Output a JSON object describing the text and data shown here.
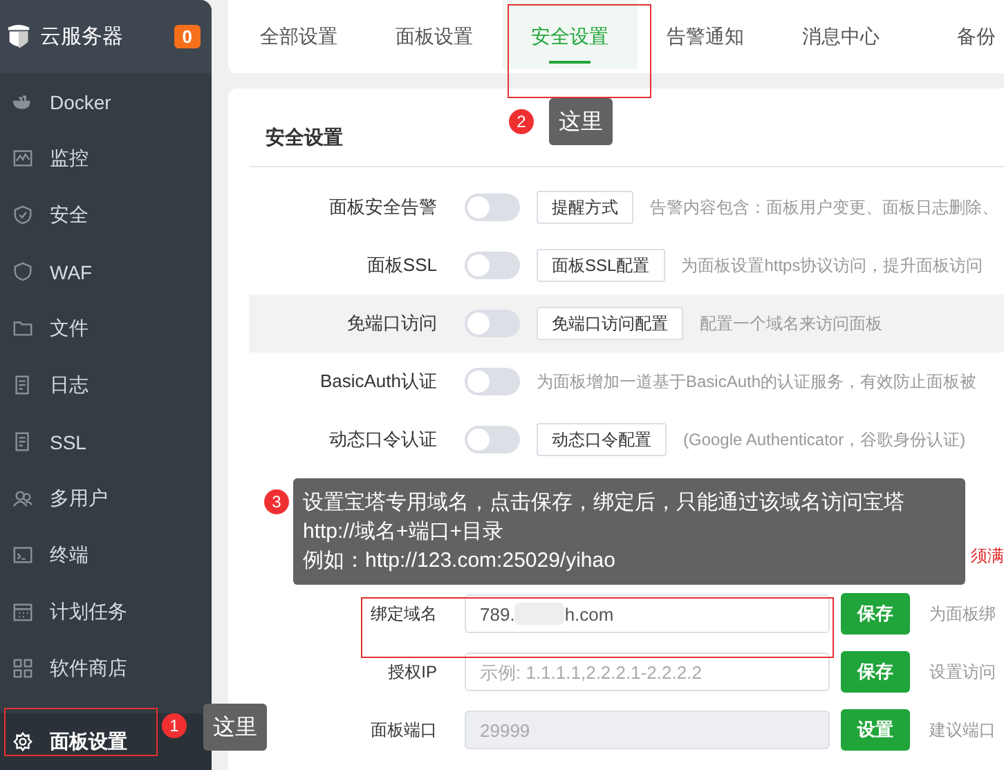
{
  "sidebar": {
    "title": "云服务器",
    "badge": "0",
    "items": [
      {
        "label": "Docker",
        "selected": false
      },
      {
        "label": "监控",
        "selected": false
      },
      {
        "label": "安全",
        "selected": false
      },
      {
        "label": "WAF",
        "selected": false
      },
      {
        "label": "文件",
        "selected": false
      },
      {
        "label": "日志",
        "selected": false
      },
      {
        "label": "SSL",
        "selected": false
      },
      {
        "label": "多用户",
        "selected": false
      },
      {
        "label": "终端",
        "selected": false
      },
      {
        "label": "计划任务",
        "selected": false
      },
      {
        "label": "软件商店",
        "selected": false
      },
      {
        "label": "面板设置",
        "selected": true
      }
    ]
  },
  "tabs": [
    {
      "label": "全部设置",
      "selected": false
    },
    {
      "label": "面板设置",
      "selected": false
    },
    {
      "label": "安全设置",
      "selected": true
    },
    {
      "label": "告警通知",
      "selected": false
    },
    {
      "label": "消息中心",
      "selected": false
    },
    {
      "label": "备份",
      "selected": false
    }
  ],
  "section": {
    "title": "安全设置"
  },
  "settings": [
    {
      "kind": "toggle",
      "label": "面板安全告警",
      "on": false,
      "button": "提醒方式",
      "description": "告警内容包含：面板用户变更、面板日志删除、",
      "highlighted": false
    },
    {
      "kind": "toggle",
      "label": "面板SSL",
      "on": false,
      "button": "面板SSL配置",
      "description": "为面板设置https协议访问，提升面板访问",
      "highlighted": false
    },
    {
      "kind": "toggle",
      "label": "免端口访问",
      "on": false,
      "button": "免端口访问配置",
      "description": "配置一个域名来访问面板",
      "highlighted": true
    },
    {
      "kind": "toggle",
      "label": "BasicAuth认证",
      "on": false,
      "description": "为面板增加一道基于BasicAuth的认证服务，有效防止面板被",
      "highlighted": false
    },
    {
      "kind": "toggle",
      "label": "动态口令认证",
      "on": false,
      "button": "动态口令配置",
      "description": "(Google Authenticator，谷歌身份认证)",
      "highlighted": false
    },
    {
      "kind": "covered"
    },
    {
      "kind": "covered",
      "warning": "须满"
    }
  ],
  "fields": [
    {
      "label": "绑定域名",
      "value_start": "789.",
      "value_end": "h.com",
      "button": "保存",
      "description": "为面板绑",
      "disabled": false
    },
    {
      "label": "授权IP",
      "placeholder": "示例: 1.1.1.1,2.2.2.1-2.2.2.2",
      "button": "保存",
      "description": "设置访问",
      "disabled": false
    },
    {
      "label": "面板端口",
      "value": "29999",
      "button": "设置",
      "description": "建议端口",
      "disabled": true
    }
  ],
  "annotations": [
    {
      "number": "1",
      "note": "这里"
    },
    {
      "number": "2",
      "note": "这里"
    },
    {
      "number": "3",
      "lines": [
        "设置宝塔专用域名，点击保存，绑定后，只能通过该域名访问宝塔",
        "http://域名+端口+目录",
        "例如：http://123.com:25029/yihao"
      ]
    }
  ]
}
